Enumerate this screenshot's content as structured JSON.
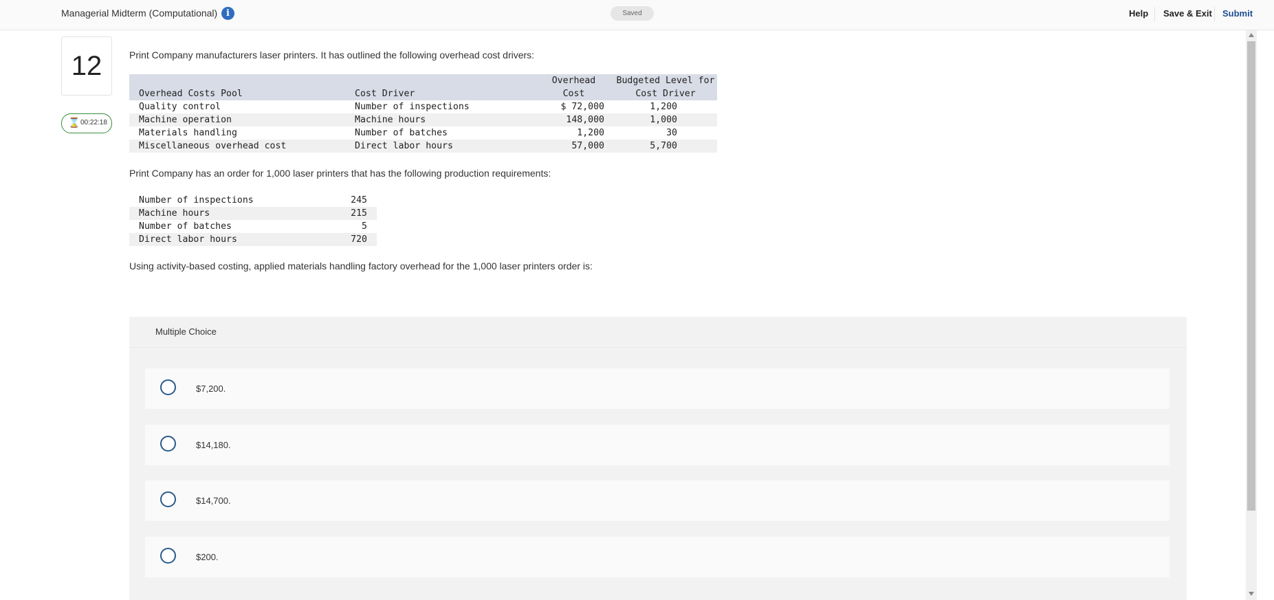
{
  "header": {
    "title": "Managerial Midterm (Computational)",
    "info_icon": "info-icon",
    "saved_status": "Saved",
    "help": "Help",
    "save_exit": "Save & Exit",
    "submit": "Submit"
  },
  "question": {
    "number": "12",
    "timer": "00:22:18",
    "timer_icon": "hourglass-icon",
    "intro": "Print Company manufacturers laser printers. It has outlined the following overhead cost drivers:",
    "cost_table": {
      "headers": {
        "pool": "Overhead Costs Pool",
        "driver": "Cost Driver",
        "cost_line1": "Overhead",
        "cost_line2": "Cost",
        "level_line1": "Budgeted Level for",
        "level_line2": "Cost Driver"
      },
      "rows": [
        {
          "pool": "Quality control",
          "driver": "Number of inspections",
          "cost": "$ 72,000",
          "level": "1,200"
        },
        {
          "pool": "Machine operation",
          "driver": "Machine hours",
          "cost": "148,000",
          "level": "1,000"
        },
        {
          "pool": "Materials handling",
          "driver": "Number of batches",
          "cost": "1,200",
          "level": "30"
        },
        {
          "pool": "Miscellaneous overhead cost",
          "driver": "Direct labor hours",
          "cost": "57,000",
          "level": "5,700"
        }
      ]
    },
    "order_text": "Print Company has an order for 1,000 laser printers that has the following production requirements:",
    "requirements": [
      {
        "label": "Number of inspections",
        "value": "245"
      },
      {
        "label": "Machine hours",
        "value": "215"
      },
      {
        "label": "Number of batches",
        "value": "5"
      },
      {
        "label": "Direct labor hours",
        "value": "720"
      }
    ],
    "prompt": "Using activity-based costing, applied materials handling factory overhead for the 1,000 laser printers order is:"
  },
  "multiple_choice": {
    "label": "Multiple Choice",
    "options": [
      "$7,200.",
      "$14,180.",
      "$14,700.",
      "$200."
    ]
  },
  "colors": {
    "accent": "#1d4f91",
    "table_header": "#d8dce6",
    "timer_border": "#3a8a3a"
  }
}
